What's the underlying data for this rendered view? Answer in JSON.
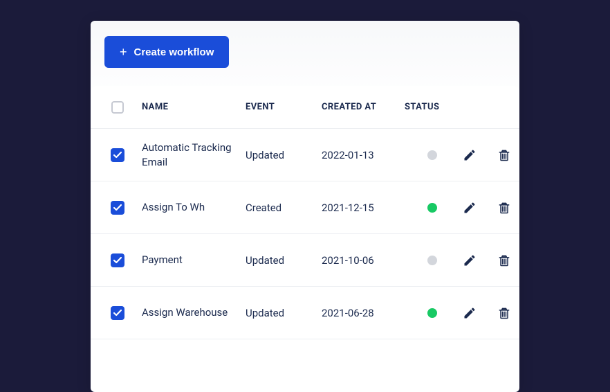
{
  "toolbar": {
    "create_label": "Create workflow"
  },
  "headers": {
    "name": "NAME",
    "event": "EVENT",
    "created": "CREATED AT",
    "status": "STATUS"
  },
  "status_colors": {
    "inactive": "#d3d6dc",
    "active": "#18c964"
  },
  "rows": [
    {
      "checked": true,
      "name": "Automatic Tracking Email",
      "event": "Updated",
      "created_at": "2022-01-13",
      "status": "inactive"
    },
    {
      "checked": true,
      "name": "Assign To Wh",
      "event": "Created",
      "created_at": "2021-12-15",
      "status": "active"
    },
    {
      "checked": true,
      "name": "Payment",
      "event": "Updated",
      "created_at": "2021-10-06",
      "status": "inactive"
    },
    {
      "checked": true,
      "name": "Assign Warehouse",
      "event": "Updated",
      "created_at": "2021-06-28",
      "status": "active"
    }
  ]
}
